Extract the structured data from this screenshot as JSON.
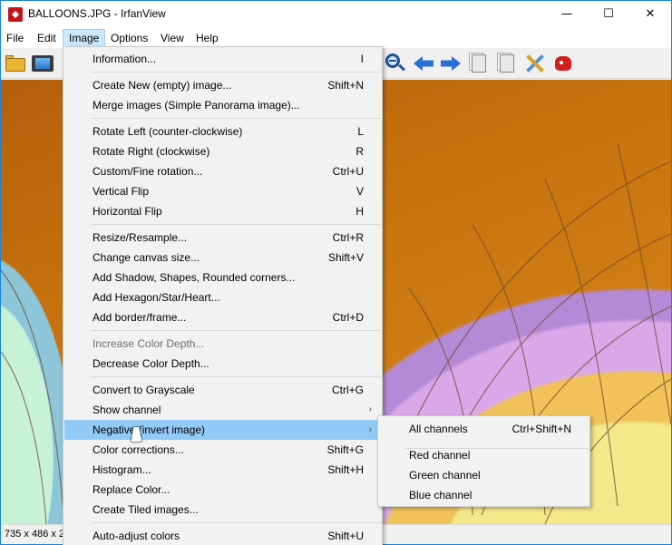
{
  "window": {
    "title": "BALLOONS.JPG - IrfanView",
    "controls": {
      "minimize": "—",
      "maximize": "☐",
      "close": "✕"
    }
  },
  "menubar": {
    "items": [
      "File",
      "Edit",
      "Image",
      "Options",
      "View",
      "Help"
    ],
    "active": "Image"
  },
  "toolbar": {
    "icons": [
      "open-folder-icon",
      "slideshow-icon",
      "zoom-out-icon",
      "previous-arrow-icon",
      "next-arrow-icon",
      "page-up-icon",
      "page-down-icon",
      "tools-icon",
      "paint-icon"
    ]
  },
  "status": {
    "text": "735 x 486 x 2"
  },
  "image_menu": {
    "items": [
      {
        "label": "Information...",
        "shortcut": "I"
      },
      {
        "label": "Create New (empty) image...",
        "shortcut": "Shift+N"
      },
      {
        "label": "Merge images (Simple Panorama image)...",
        "shortcut": ""
      },
      {
        "label": "Rotate Left (counter-clockwise)",
        "shortcut": "L"
      },
      {
        "label": "Rotate Right (clockwise)",
        "shortcut": "R"
      },
      {
        "label": "Custom/Fine rotation...",
        "shortcut": "Ctrl+U"
      },
      {
        "label": "Vertical Flip",
        "shortcut": "V"
      },
      {
        "label": "Horizontal Flip",
        "shortcut": "H"
      },
      {
        "label": "Resize/Resample...",
        "shortcut": "Ctrl+R"
      },
      {
        "label": "Change canvas size...",
        "shortcut": "Shift+V"
      },
      {
        "label": "Add Shadow, Shapes, Rounded corners...",
        "shortcut": ""
      },
      {
        "label": "Add Hexagon/Star/Heart...",
        "shortcut": ""
      },
      {
        "label": "Add border/frame...",
        "shortcut": "Ctrl+D"
      },
      {
        "label": "Increase Color Depth...",
        "shortcut": "",
        "disabled": true
      },
      {
        "label": "Decrease Color Depth...",
        "shortcut": ""
      },
      {
        "label": "Convert to Grayscale",
        "shortcut": "Ctrl+G"
      },
      {
        "label": "Show channel",
        "shortcut": "",
        "submenu": "›"
      },
      {
        "label": "Negative (invert image)",
        "shortcut": "",
        "submenu": "›",
        "highlighted": true
      },
      {
        "label": "Color corrections...",
        "shortcut": "Shift+G"
      },
      {
        "label": "Histogram...",
        "shortcut": "Shift+H"
      },
      {
        "label": "Replace Color...",
        "shortcut": ""
      },
      {
        "label": "Create Tiled images...",
        "shortcut": ""
      },
      {
        "label": "Auto-adjust colors",
        "shortcut": "Shift+U"
      }
    ]
  },
  "negative_submenu": {
    "items": [
      {
        "label": "All channels",
        "shortcut": "Ctrl+Shift+N"
      },
      {
        "label": "Red channel",
        "shortcut": ""
      },
      {
        "label": "Green channel",
        "shortcut": ""
      },
      {
        "label": "Blue channel",
        "shortcut": ""
      }
    ]
  },
  "colors": {
    "highlight": "#91c9f7",
    "menu_bg": "#f2f2f2",
    "active_menu": "#cce8ff",
    "border": "#1883d7"
  }
}
